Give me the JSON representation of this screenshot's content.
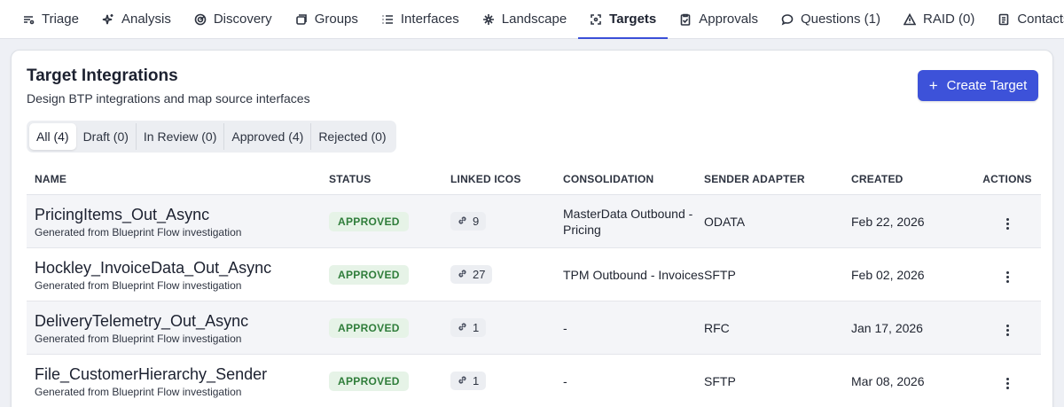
{
  "nav": {
    "tabs": [
      {
        "label": "Triage",
        "icon": "triage-icon"
      },
      {
        "label": "Analysis",
        "icon": "sparkle-icon"
      },
      {
        "label": "Discovery",
        "icon": "radar-icon"
      },
      {
        "label": "Groups",
        "icon": "layers-icon"
      },
      {
        "label": "Interfaces",
        "icon": "list-icon"
      },
      {
        "label": "Landscape",
        "icon": "network-icon"
      },
      {
        "label": "Targets",
        "icon": "target-icon",
        "active": true
      },
      {
        "label": "Approvals",
        "icon": "clipboard-check-icon"
      },
      {
        "label": "Questions (1)",
        "icon": "chat-bubble-icon"
      },
      {
        "label": "RAID (0)",
        "icon": "warning-triangle-icon"
      },
      {
        "label": "Contacts",
        "icon": "address-book-icon"
      }
    ]
  },
  "header": {
    "title": "Target Integrations",
    "subtitle": "Design BTP integrations and map source interfaces",
    "create_button": "Create Target",
    "create_icon": "plus-icon"
  },
  "filters": [
    {
      "label": "All (4)",
      "active": true
    },
    {
      "label": "Draft (0)"
    },
    {
      "label": "In Review (0)"
    },
    {
      "label": "Approved (4)"
    },
    {
      "label": "Rejected (0)"
    }
  ],
  "table": {
    "columns": [
      "NAME",
      "STATUS",
      "LINKED ICOS",
      "CONSOLIDATION",
      "SENDER ADAPTER",
      "CREATED",
      "ACTIONS"
    ],
    "rows": [
      {
        "name": "PricingItems_Out_Async",
        "sub": "Generated from Blueprint Flow investigation",
        "status": "APPROVED",
        "linked_icos": "9",
        "consolidation": "MasterData Outbound - Pricing",
        "adapter": "ODATA",
        "created": "Feb 22, 2026"
      },
      {
        "name": "Hockley_InvoiceData_Out_Async",
        "sub": "Generated from Blueprint Flow investigation",
        "status": "APPROVED",
        "linked_icos": "27",
        "consolidation": "TPM Outbound - Invoices",
        "adapter": "SFTP",
        "created": "Feb 02, 2026"
      },
      {
        "name": "DeliveryTelemetry_Out_Async",
        "sub": "Generated from Blueprint Flow investigation",
        "status": "APPROVED",
        "linked_icos": "1",
        "consolidation": "-",
        "adapter": "RFC",
        "created": "Jan 17, 2026"
      },
      {
        "name": "File_CustomerHierarchy_Sender",
        "sub": "Generated from Blueprint Flow investigation",
        "status": "APPROVED",
        "linked_icos": "1",
        "consolidation": "-",
        "adapter": "SFTP",
        "created": "Mar 08, 2026"
      }
    ]
  },
  "colors": {
    "accent": "#3d52d9",
    "status_approved_bg": "#e6f3e7",
    "status_approved_text": "#2f7d3a"
  }
}
